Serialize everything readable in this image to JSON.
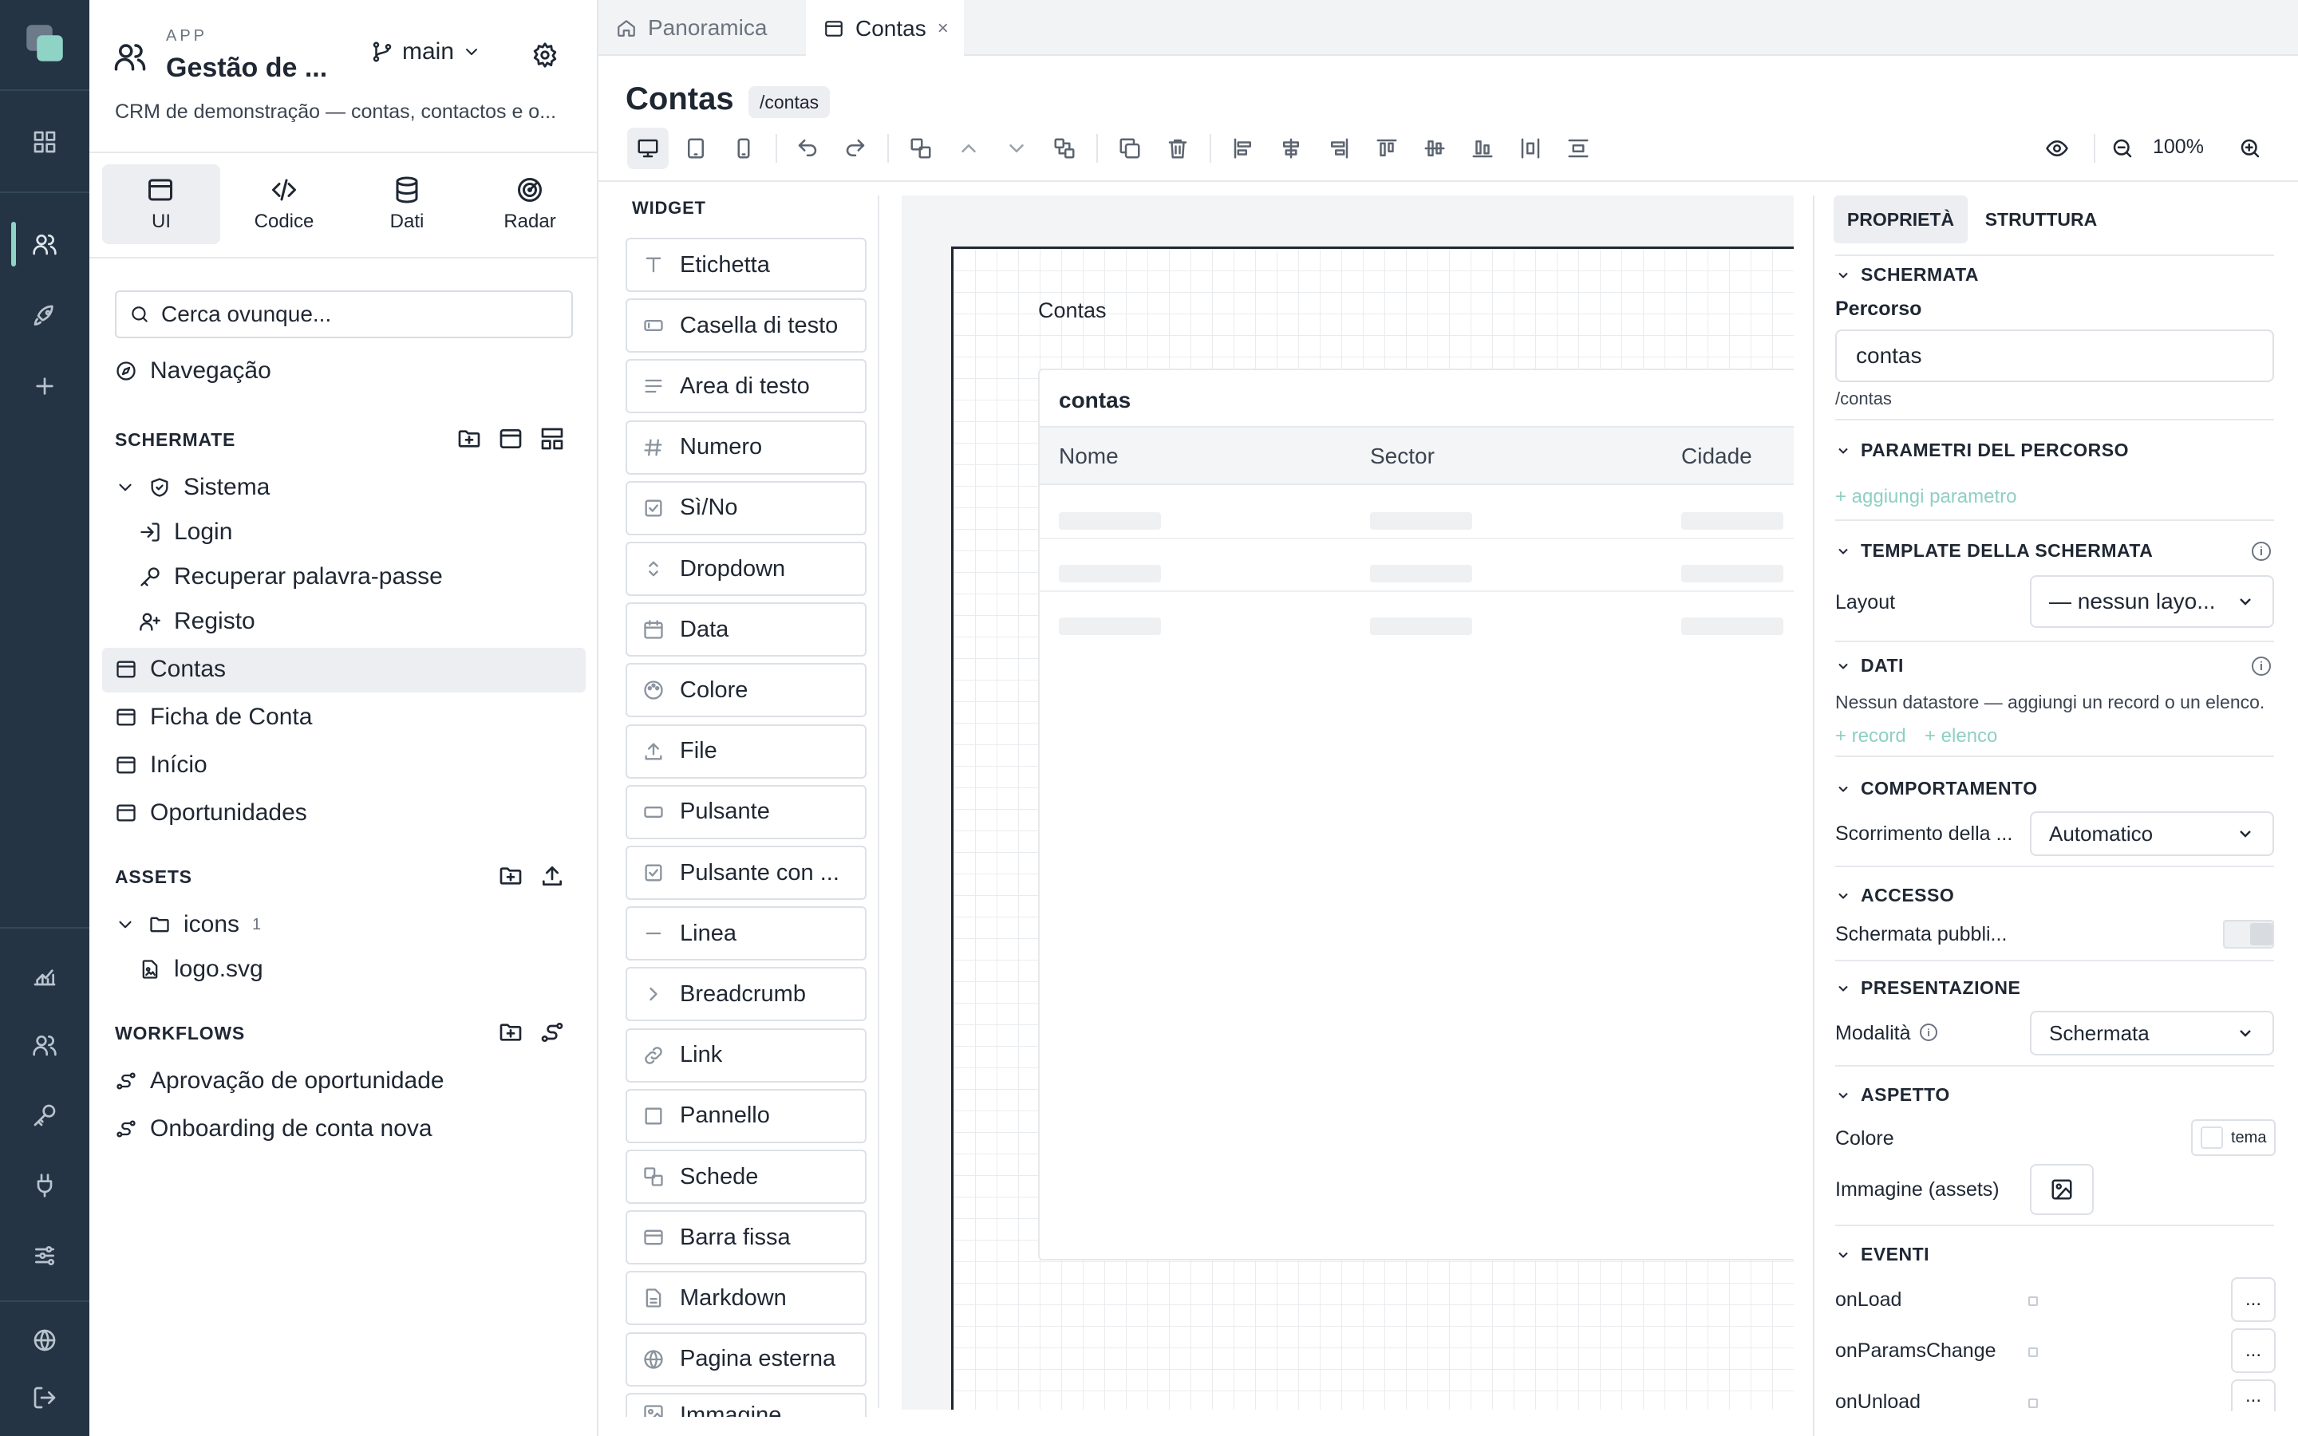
{
  "app": {
    "eyebrow": "APP",
    "name": "Gestão de ...",
    "branch": "main",
    "description": "CRM de demonstração — contas, contactos e o..."
  },
  "mode_tabs": [
    {
      "label": "UI",
      "icon": "window-icon",
      "active": true
    },
    {
      "label": "Codice",
      "icon": "code-icon"
    },
    {
      "label": "Dati",
      "icon": "database-icon"
    },
    {
      "label": "Radar",
      "icon": "radar-icon"
    }
  ],
  "search": {
    "placeholder": "Cerca ovunque..."
  },
  "navigation_label": "Navegação",
  "screens": {
    "title": "SCHERMATE",
    "group": "Sistema",
    "group_children": [
      "Login",
      "Recuperar palavra-passe",
      "Registo"
    ],
    "items": [
      "Contas",
      "Ficha de Conta",
      "Início",
      "Oportunidades"
    ],
    "active": "Contas"
  },
  "assets": {
    "title": "ASSETS",
    "folder": "icons",
    "folder_count": "1",
    "file": "logo.svg"
  },
  "workflows": {
    "title": "WORKFLOWS",
    "items": [
      "Aprovação de oportunidade",
      "Onboarding de conta nova"
    ]
  },
  "editor_tabs": [
    {
      "label": "Panoramica",
      "icon": "home-icon",
      "active": false
    },
    {
      "label": "Contas",
      "icon": "window-icon",
      "active": true,
      "close": "×"
    }
  ],
  "page": {
    "title": "Contas",
    "route_badge": "/contas"
  },
  "toolbar": {
    "zoom": "100%"
  },
  "widgets": {
    "title": "WIDGET",
    "items": [
      "Etichetta",
      "Casella di testo",
      "Area di testo",
      "Numero",
      "Sì/No",
      "Dropdown",
      "Data",
      "Colore",
      "File",
      "Pulsante",
      "Pulsante con ...",
      "Linea",
      "Breadcrumb",
      "Link",
      "Pannello",
      "Schede",
      "Barra fissa",
      "Markdown",
      "Pagina esterna",
      "Immagine"
    ]
  },
  "canvas": {
    "heading": "Contas",
    "table_title": "contas",
    "columns": [
      "Nome",
      "Sector",
      "Cidade"
    ]
  },
  "inspector": {
    "tabs": [
      "PROPRIETÀ",
      "STRUTTURA"
    ],
    "schermata": {
      "title": "SCHERMATA",
      "path_label": "Percorso",
      "path_value": "contas",
      "path_hint": "/contas"
    },
    "params": {
      "title": "PARAMETRI DEL PERCORSO",
      "add": "+ aggiungi parametro"
    },
    "template": {
      "title": "TEMPLATE DELLA SCHERMATA",
      "layout_label": "Layout",
      "layout_value": "— nessun layo..."
    },
    "dati": {
      "title": "DATI",
      "empty": "Nessun datastore — aggiungi un record o un elenco.",
      "add_record": "+ record",
      "add_list": "+ elenco"
    },
    "behaviour": {
      "title": "COMPORTAMENTO",
      "scroll_label": "Scorrimento della ...",
      "scroll_value": "Automatico"
    },
    "access": {
      "title": "ACCESSO",
      "public_label": "Schermata pubbli...",
      "public_enabled": false
    },
    "presentation": {
      "title": "PRESENTAZIONE",
      "mode_label": "Modalità",
      "mode_value": "Schermata"
    },
    "appearance": {
      "title": "ASPETTO",
      "color_label": "Colore",
      "color_value": "tema",
      "image_label": "Immagine (assets)"
    },
    "events": {
      "title": "EVENTI",
      "items": [
        "onLoad",
        "onParamsChange",
        "onUnload"
      ],
      "button": "..."
    }
  },
  "colors": {
    "rail": "#243444",
    "accent": "#8fd3c7",
    "link_green": "#8fcfc4"
  }
}
